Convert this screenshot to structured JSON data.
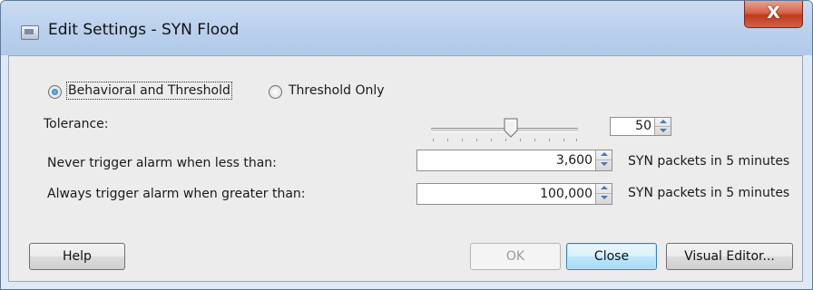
{
  "window": {
    "title": "Edit Settings - SYN Flood",
    "close_glyph": "X"
  },
  "mode": {
    "options": [
      {
        "label": "Behavioral and Threshold",
        "selected": true
      },
      {
        "label": "Threshold Only",
        "selected": false
      }
    ]
  },
  "tolerance": {
    "label": "Tolerance:",
    "slider_fraction": 0.55,
    "value": "50"
  },
  "never_trigger": {
    "label": "Never trigger alarm when less than:",
    "value": "3,600",
    "unit": "SYN packets in 5 minutes"
  },
  "always_trigger": {
    "label": "Always trigger alarm when greater than:",
    "value": "100,000",
    "unit": "SYN packets in 5 minutes"
  },
  "buttons": {
    "help": "Help",
    "ok": "OK",
    "close": "Close",
    "visual_editor": "Visual Editor..."
  },
  "colors": {
    "titlebar": "#bcd2ee",
    "close_button": "#c0391e",
    "default_button": "#a7d9f5"
  }
}
